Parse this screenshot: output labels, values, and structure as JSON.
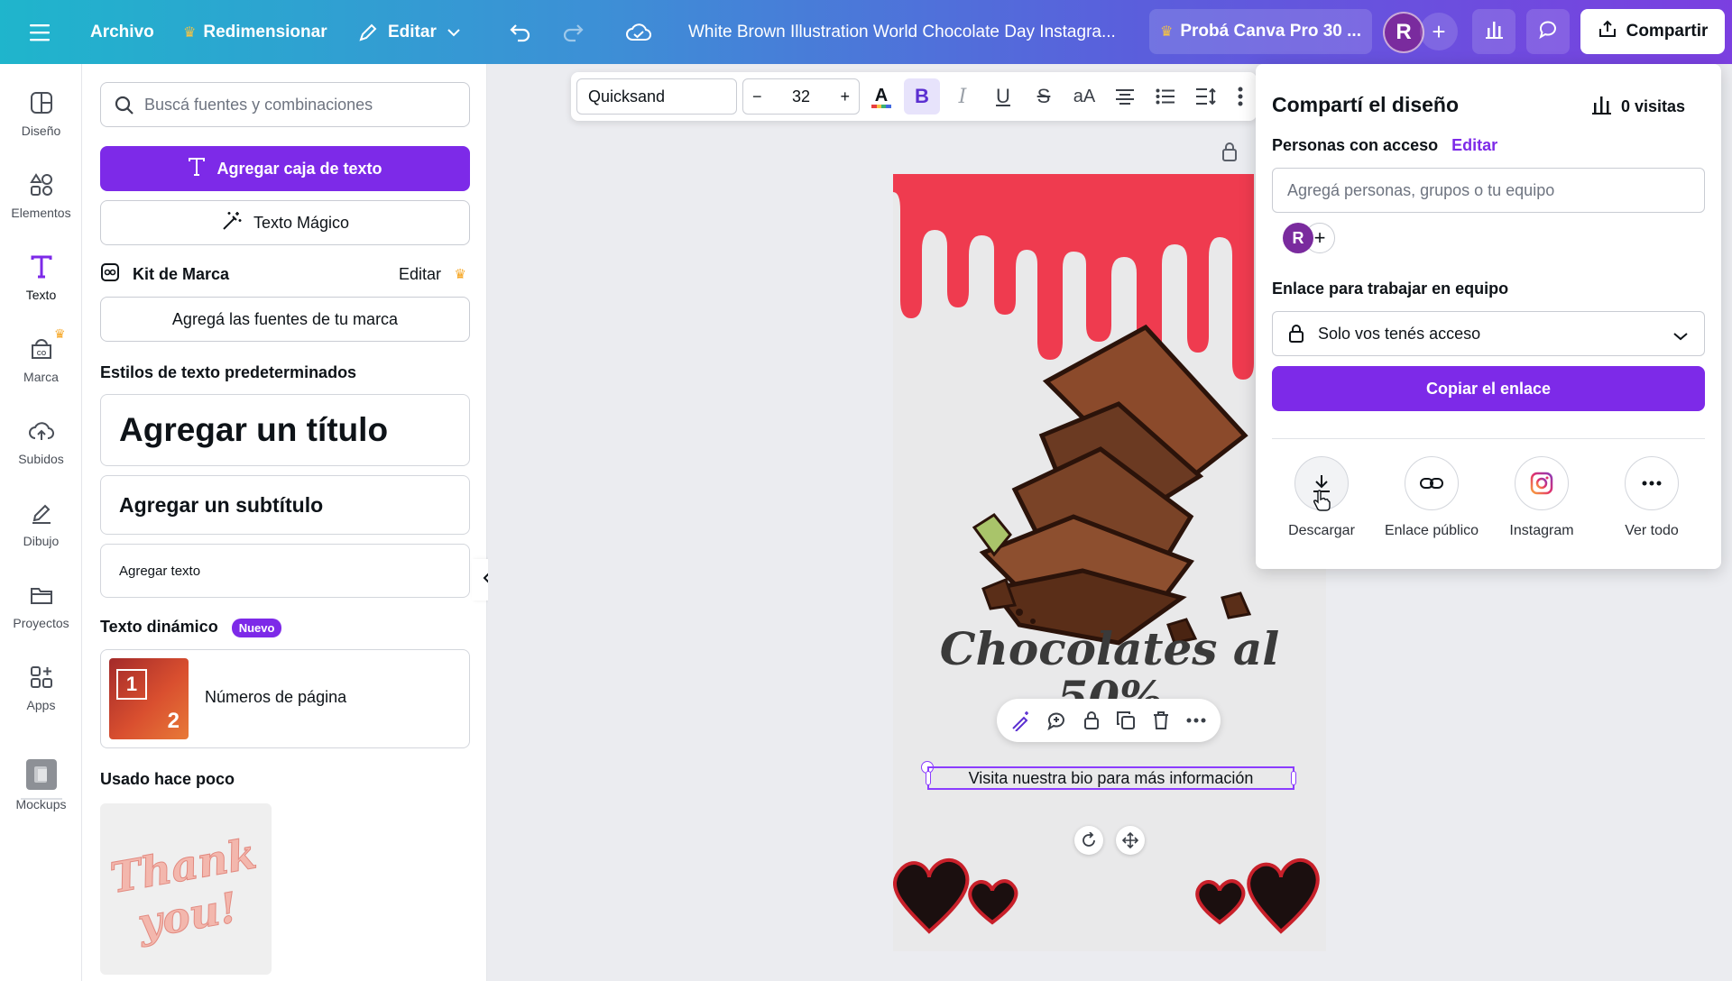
{
  "topbar": {
    "menu_icon": "hamburger-icon",
    "file": "Archivo",
    "resize": "Redimensionar",
    "edit": "Editar",
    "title": "White Brown Illustration World Chocolate Day Instagra...",
    "pro": "Probá Canva Pro 30 ...",
    "user_initial": "R",
    "share": "Compartir",
    "colors": {
      "crown": "#f6c343"
    }
  },
  "rail": {
    "items": [
      {
        "label": "Diseño",
        "icon": "design-icon"
      },
      {
        "label": "Elementos",
        "icon": "elements-icon"
      },
      {
        "label": "Texto",
        "icon": "text-icon"
      },
      {
        "label": "Marca",
        "icon": "brand-icon"
      },
      {
        "label": "Subidos",
        "icon": "upload-cloud-icon"
      },
      {
        "label": "Dibujo",
        "icon": "draw-icon"
      },
      {
        "label": "Proyectos",
        "icon": "folder-icon"
      },
      {
        "label": "Apps",
        "icon": "apps-icon"
      },
      {
        "label": "Mockups",
        "icon": "mockups-icon"
      }
    ]
  },
  "panel": {
    "search_placeholder": "Buscá fuentes y combinaciones",
    "add_textbox": "Agregar caja de texto",
    "magic_text": "Texto Mágico",
    "brand_kit": "Kit de Marca",
    "brand_kit_edit": "Editar",
    "add_brand_fonts": "Agregá las fuentes de tu marca",
    "default_styles": "Estilos de texto predeterminados",
    "add_title": "Agregar un título",
    "add_subtitle": "Agregar un subtítulo",
    "add_text": "Agregar texto",
    "dynamic_text": "Texto dinámico",
    "new_badge": "Nuevo",
    "page_numbers": "Números de página",
    "page_numbers_thumb_1": "1",
    "page_numbers_thumb_2": "2",
    "recently_used": "Usado hace poco",
    "recent_thumb_text": "Thank you!"
  },
  "format_bar": {
    "font": "Quicksand",
    "size": "32",
    "minus": "−",
    "plus": "+",
    "text_case": "aA"
  },
  "canvas": {
    "headline": "Chocolates al",
    "headline_line2": "50%",
    "selected_text": "Visita nuestra bio para más información"
  },
  "share": {
    "title": "Compartí el diseño",
    "visits": "0 visitas",
    "people_access": "Personas con acceso",
    "people_edit": "Editar",
    "add_people_placeholder": "Agregá personas, grupos o tu equipo",
    "avatar_initial": "R",
    "team_link_label": "Enlace para trabajar en equipo",
    "access_option": "Solo vos tenés acceso",
    "copy_link": "Copiar el enlace",
    "actions": [
      {
        "label": "Descargar",
        "icon": "download-icon"
      },
      {
        "label": "Enlace público",
        "icon": "link-icon"
      },
      {
        "label": "Instagram",
        "icon": "instagram-icon"
      },
      {
        "label": "Ver todo",
        "icon": "more-icon"
      }
    ]
  },
  "colors": {
    "accent": "#7d2ae8",
    "drip": "#ef3b4f",
    "chocolate": "#6b3a22"
  }
}
